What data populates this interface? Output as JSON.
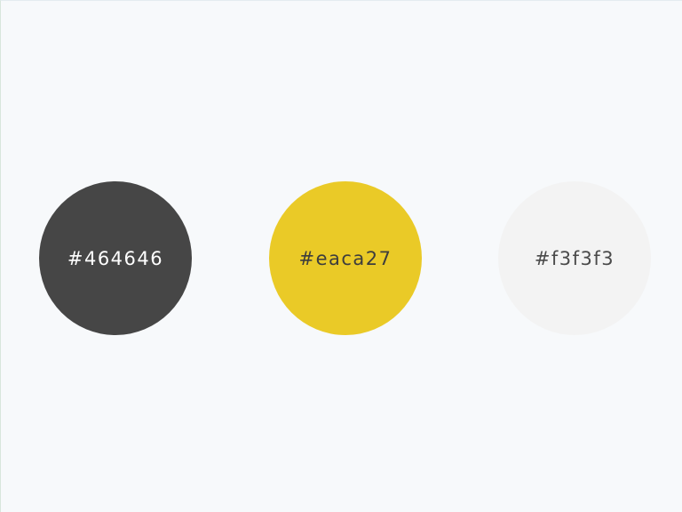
{
  "swatches": [
    {
      "label": "#464646",
      "color": "#464646",
      "text_color": "#ffffff"
    },
    {
      "label": "#eaca27",
      "color": "#eaca27",
      "text_color": "#3d3d3d"
    },
    {
      "label": "#f3f3f3",
      "color": "#f3f3f3",
      "text_color": "#4a4a4a"
    }
  ]
}
